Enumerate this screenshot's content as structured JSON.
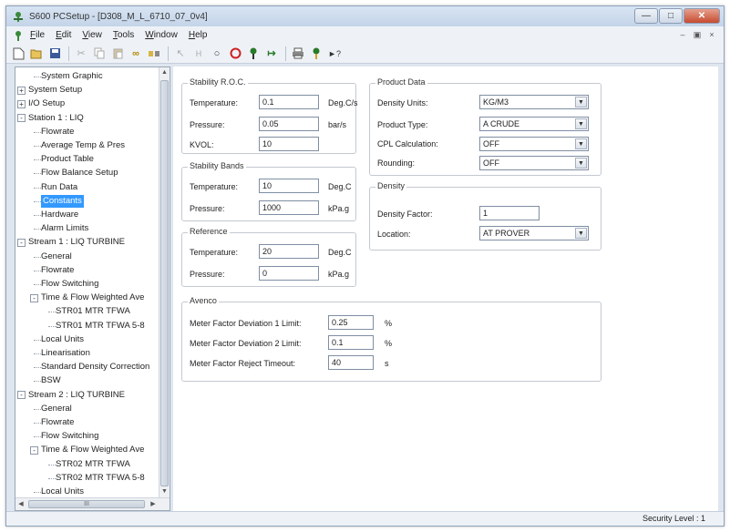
{
  "window": {
    "title": "S600 PCSetup  -  [D308_M_L_6710_07_0v4]"
  },
  "menu": [
    "File",
    "Edit",
    "View",
    "Tools",
    "Window",
    "Help"
  ],
  "toolbar": {
    "buttons": [
      "new-icon",
      "open-icon",
      "save-icon",
      "cut-icon",
      "copy-icon",
      "paste-icon",
      "link-icon",
      "connect-icon",
      "pointer-icon",
      "step-icon",
      "loop-icon",
      "stop-icon",
      "pin-icon",
      "push-icon",
      "print-icon",
      "help-icon",
      "whats-this-icon"
    ]
  },
  "tree": {
    "items": [
      {
        "label": "System Graphic",
        "level": 1
      },
      {
        "label": "System Setup",
        "level": 0,
        "expander": "+"
      },
      {
        "label": "I/O Setup",
        "level": 0,
        "expander": "+"
      },
      {
        "label": "Station 1 : LIQ",
        "level": 0,
        "expander": "-"
      },
      {
        "label": "Flowrate",
        "level": 1
      },
      {
        "label": "Average Temp & Pres",
        "level": 1
      },
      {
        "label": "Product Table",
        "level": 1
      },
      {
        "label": "Flow Balance Setup",
        "level": 1
      },
      {
        "label": "Run Data",
        "level": 1
      },
      {
        "label": "Constants",
        "level": 1,
        "selected": true
      },
      {
        "label": "Hardware",
        "level": 1
      },
      {
        "label": "Alarm Limits",
        "level": 1
      },
      {
        "label": "Stream 1 : LIQ TURBINE",
        "level": 0,
        "expander": "-"
      },
      {
        "label": "General",
        "level": 1
      },
      {
        "label": "Flowrate",
        "level": 1
      },
      {
        "label": "Flow Switching",
        "level": 1
      },
      {
        "label": "Time & Flow Weighted Ave",
        "level": 1,
        "expander": "-"
      },
      {
        "label": "STR01 MTR TFWA",
        "level": 2
      },
      {
        "label": "STR01 MTR TFWA 5-8",
        "level": 2
      },
      {
        "label": "Local Units",
        "level": 1
      },
      {
        "label": "Linearisation",
        "level": 1
      },
      {
        "label": "Standard Density Correction",
        "level": 1
      },
      {
        "label": "BSW",
        "level": 1
      },
      {
        "label": "Stream 2 : LIQ TURBINE",
        "level": 0,
        "expander": "-"
      },
      {
        "label": "General",
        "level": 1
      },
      {
        "label": "Flowrate",
        "level": 1
      },
      {
        "label": "Flow Switching",
        "level": 1
      },
      {
        "label": "Time & Flow Weighted Ave",
        "level": 1,
        "expander": "-"
      },
      {
        "label": "STR02 MTR TFWA",
        "level": 2
      },
      {
        "label": "STR02 MTR TFWA 5-8",
        "level": 2
      },
      {
        "label": "Local Units",
        "level": 1
      }
    ],
    "hscroll_thumb_glyph": "III"
  },
  "stability_roc": {
    "legend": "Stability R.O.C.",
    "temperature_label": "Temperature:",
    "temperature_value": "0.1",
    "temperature_unit": "Deg.C/s",
    "pressure_label": "Pressure:",
    "pressure_value": "0.05",
    "pressure_unit": "bar/s",
    "kvol_label": "KVOL:",
    "kvol_value": "10"
  },
  "stability_bands": {
    "legend": "Stability Bands",
    "temperature_label": "Temperature:",
    "temperature_value": "10",
    "temperature_unit": "Deg.C",
    "pressure_label": "Pressure:",
    "pressure_value": "1000",
    "pressure_unit": "kPa.g"
  },
  "reference": {
    "legend": "Reference",
    "temperature_label": "Temperature:",
    "temperature_value": "20",
    "temperature_unit": "Deg.C",
    "pressure_label": "Pressure:",
    "pressure_value": "0",
    "pressure_unit": "kPa.g"
  },
  "product_data": {
    "legend": "Product Data",
    "density_units_label": "Density Units:",
    "density_units_value": "KG/M3",
    "product_type_label": "Product Type:",
    "product_type_value": "A CRUDE",
    "cpl_label": "CPL Calculation:",
    "cpl_value": "OFF",
    "rounding_label": "Rounding:",
    "rounding_value": "OFF"
  },
  "density": {
    "legend": "Density",
    "factor_label": "Density Factor:",
    "factor_value": "1",
    "location_label": "Location:",
    "location_value": "AT PROVER"
  },
  "avenco": {
    "legend": "Avenco",
    "dev1_label": "Meter Factor Deviation 1 Limit:",
    "dev1_value": "0.25",
    "dev1_unit": "%",
    "dev2_label": "Meter Factor Deviation 2 Limit:",
    "dev2_value": "0.1",
    "dev2_unit": "%",
    "timeout_label": "Meter Factor Reject Timeout:",
    "timeout_value": "40",
    "timeout_unit": "s"
  },
  "status": {
    "security": "Security Level : 1"
  }
}
